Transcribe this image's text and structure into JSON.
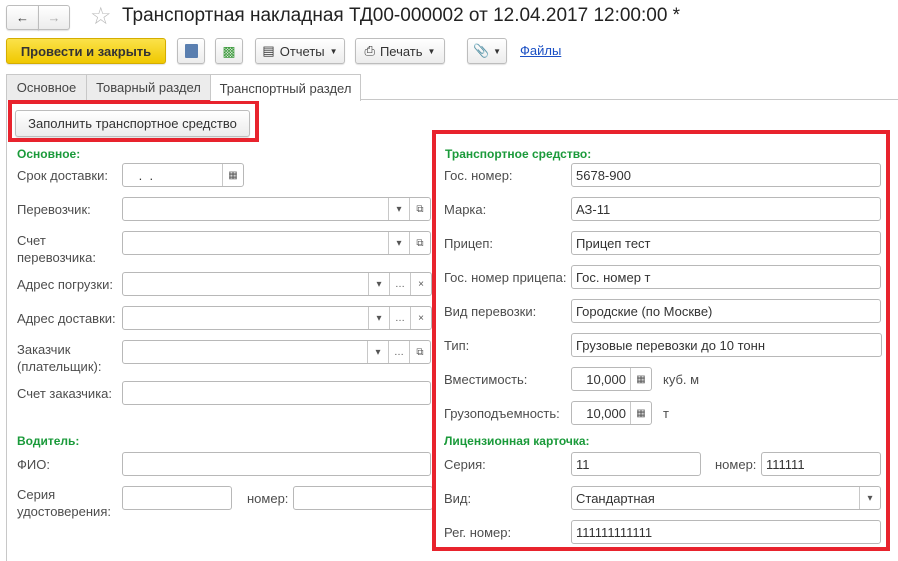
{
  "header": {
    "title": "Транспортная накладная ТД00-000002 от 12.04.2017 12:00:00 *"
  },
  "toolbar": {
    "post_close": "Провести и закрыть",
    "reports": "Отчеты",
    "print": "Печать",
    "files": "Файлы"
  },
  "tabs": [
    "Основное",
    "Товарный раздел",
    "Транспортный раздел"
  ],
  "fill_button": "Заполнить транспортное средство",
  "left": {
    "main_group": "Основное:",
    "delivery_term": {
      "label": "Срок доставки:",
      "value": " .  ."
    },
    "carrier": "Перевозчик:",
    "carrier_account": [
      "Счет",
      "перевозчика:"
    ],
    "loading_address": "Адрес погрузки:",
    "delivery_address": "Адрес доставки:",
    "customer": [
      "Заказчик",
      "(плательщик):"
    ],
    "customer_account": "Счет заказчика:",
    "driver_group": "Водитель:",
    "fio": "ФИО:",
    "license_series": [
      "Серия",
      "удостоверения:"
    ],
    "number": "номер:"
  },
  "right": {
    "vehicle_group": "Транспортное средство:",
    "plate": {
      "label": "Гос. номер:",
      "value": "5678-900"
    },
    "brand": {
      "label": "Марка:",
      "value": "АЗ-11"
    },
    "trailer": {
      "label": "Прицеп:",
      "value": "Прицеп тест"
    },
    "trailer_plate": {
      "label": "Гос. номер прицепа:",
      "value": "Гос. номер т"
    },
    "transport_kind": {
      "label": "Вид перевозки:",
      "value": "Городские (по Москве)"
    },
    "type": {
      "label": "Тип:",
      "value": "Грузовые перевозки до 10 тонн"
    },
    "capacity": {
      "label": "Вместимость:",
      "value": "10,000",
      "unit": "куб. м"
    },
    "load_capacity": {
      "label": "Грузоподъемность:",
      "value": "10,000",
      "unit": "т"
    },
    "license_group": "Лицензионная карточка:",
    "series": {
      "label": "Серия:",
      "value": "11"
    },
    "number": {
      "label": "номер:",
      "value": "111111"
    },
    "kind": {
      "label": "Вид:",
      "value": "Стандартная"
    },
    "reg_number": {
      "label": "Рег. номер:",
      "value": "111111111111"
    }
  },
  "colors": {
    "accent_yellow": "#f6d21a",
    "highlight_red": "#e8232d",
    "group_green": "#1a9a3a",
    "link_blue": "#1a4fc4"
  }
}
